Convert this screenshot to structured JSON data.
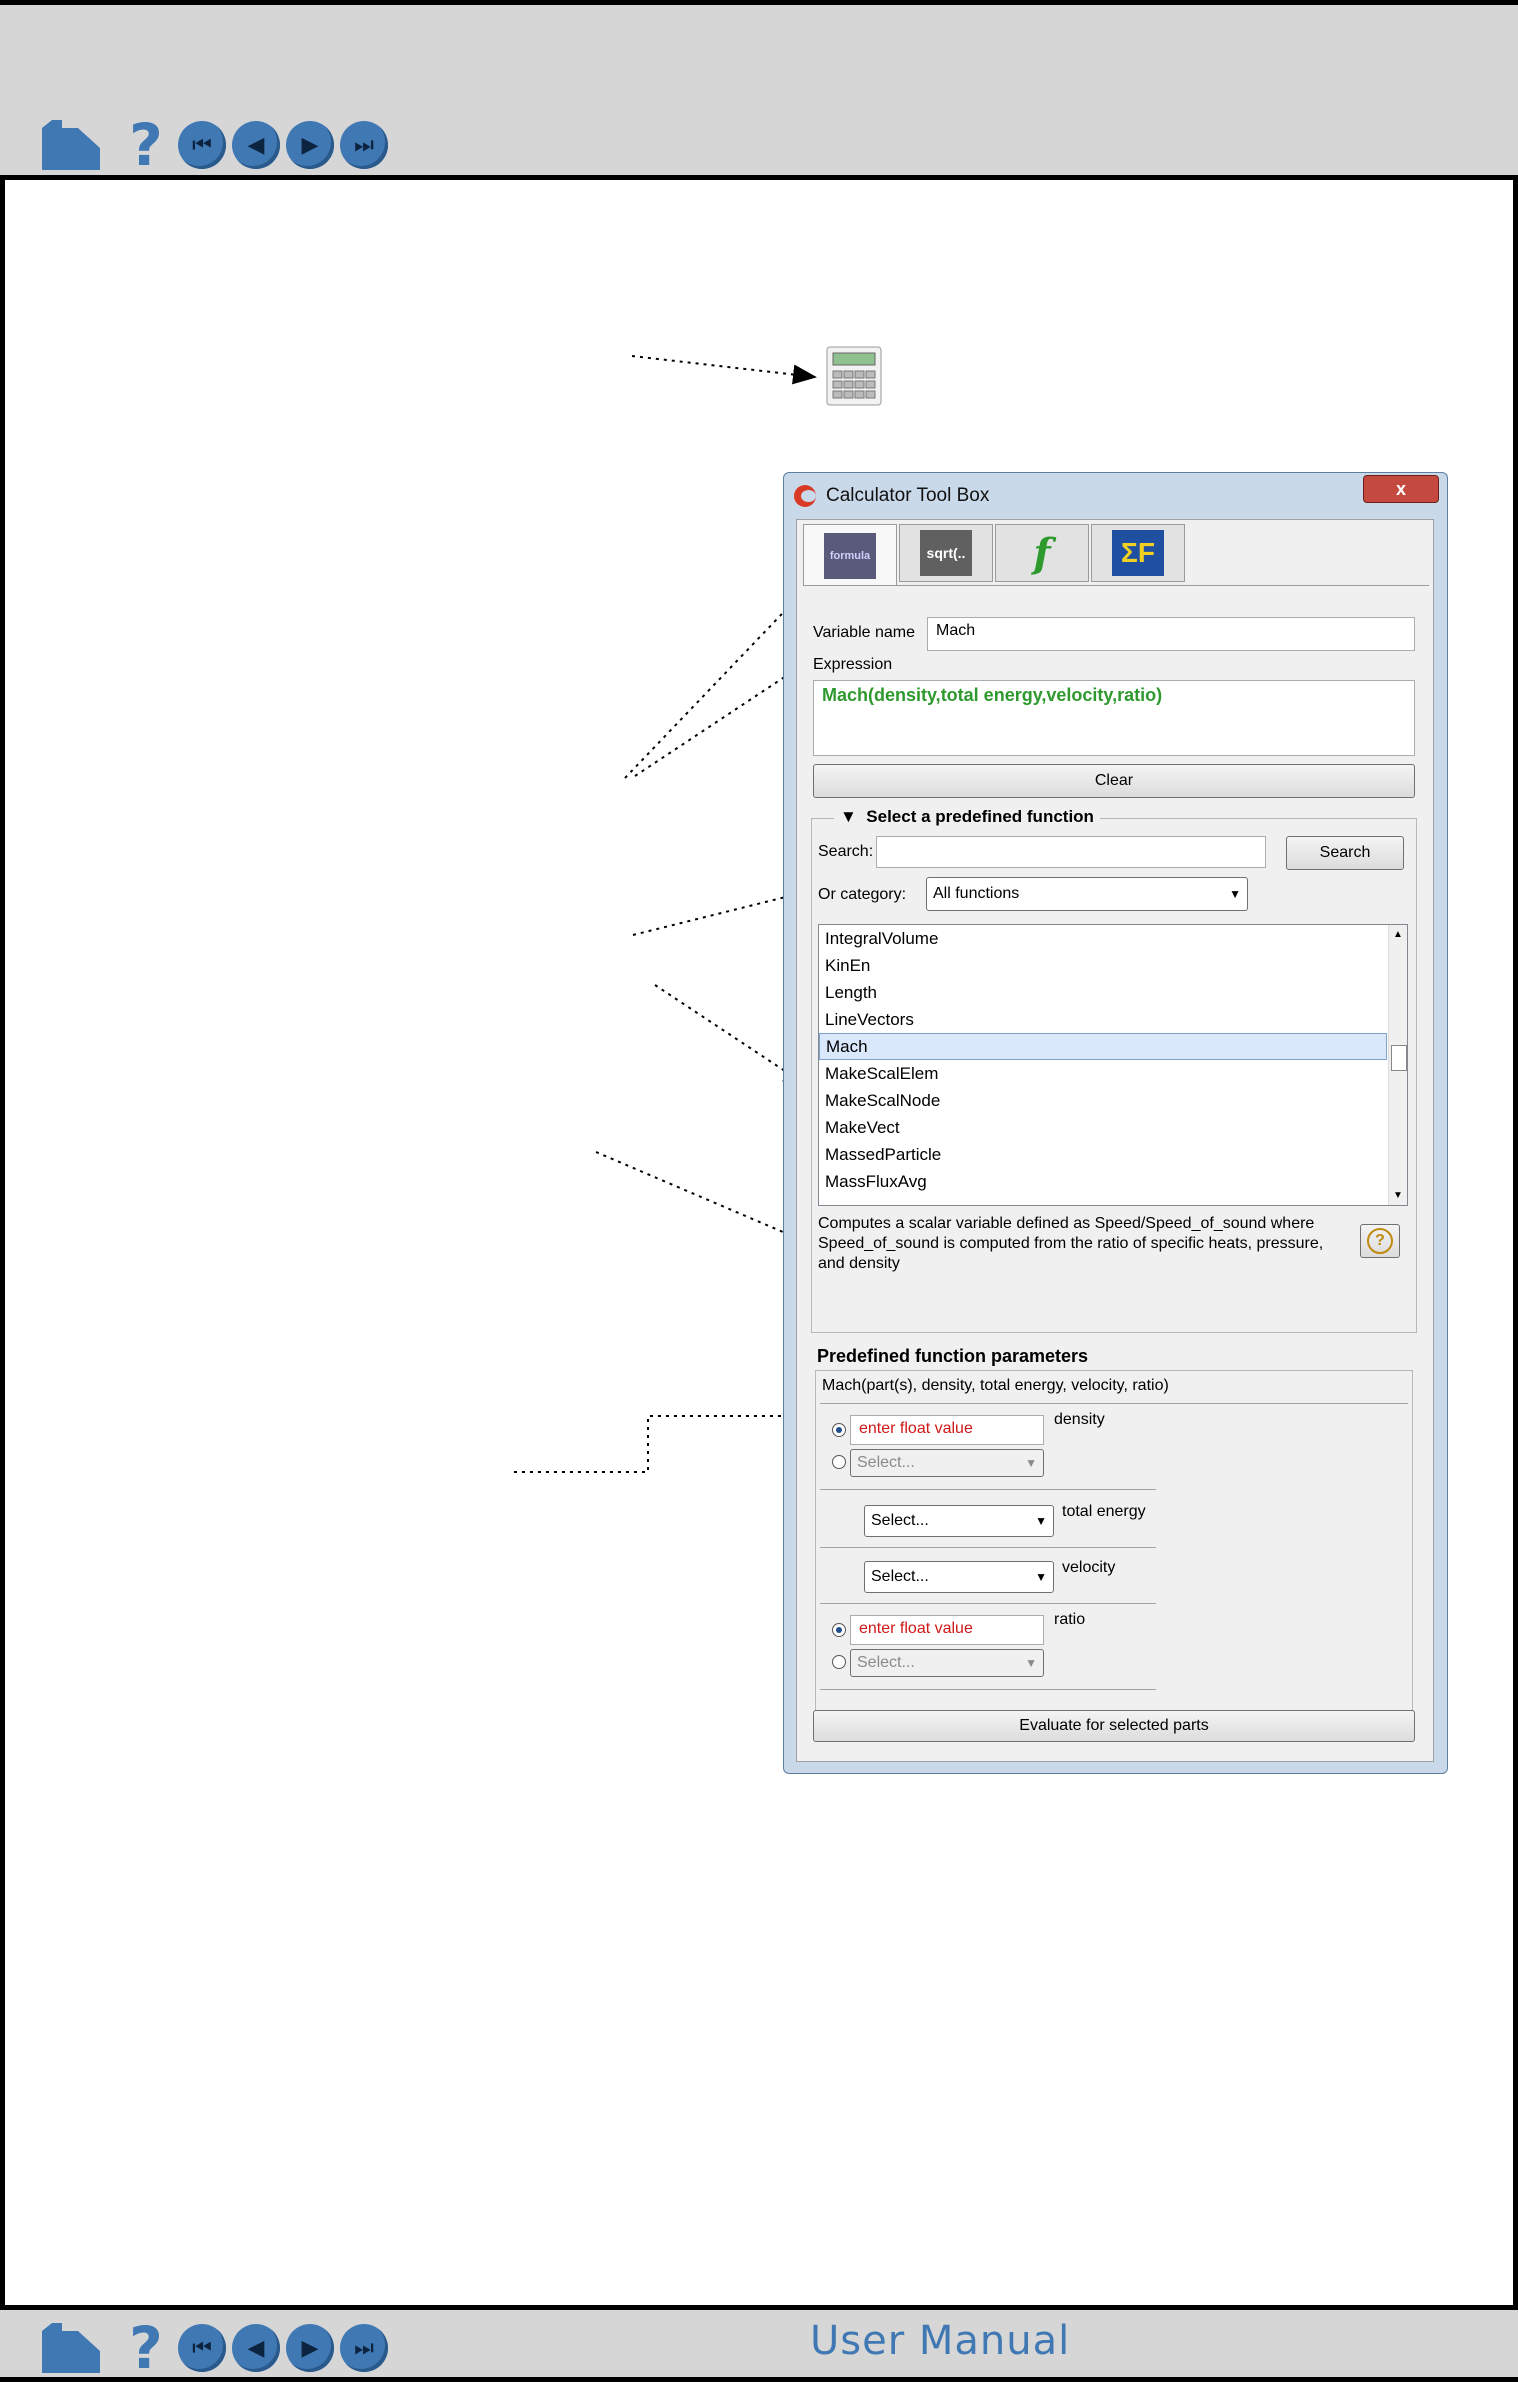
{
  "nav": {
    "home_icon": "home-icon",
    "help_glyph": "?",
    "buttons": [
      "first-page-icon",
      "previous-page-icon",
      "next-page-icon",
      "last-page-icon"
    ],
    "first_glyph": "⏮",
    "prev_glyph": "◀",
    "next_glyph": "▶",
    "last_glyph": "⏭"
  },
  "footer": {
    "title": "User Manual"
  },
  "dialog": {
    "title": "Calculator Tool Box",
    "close_glyph": "x",
    "tabs": [
      {
        "icon": "general-formula-icon",
        "text": "formula"
      },
      {
        "icon": "sqrt-function-icon",
        "text": "sqrt(.."
      },
      {
        "icon": "user-function-icon",
        "text": "f"
      },
      {
        "icon": "sum-function-icon",
        "text": "ΣF"
      }
    ],
    "variable_name_label": "Variable name",
    "variable_name_value": "Mach",
    "expression_label": "Expression",
    "expression_value": "Mach(density,total energy,velocity,ratio)",
    "clear_label": "Clear",
    "predefined_header": "Select a predefined function",
    "search_label": "Search:",
    "search_value": "",
    "search_button": "Search",
    "category_label": "Or category:",
    "category_value": "All functions",
    "functions": [
      "IntegralVolume",
      "KinEn",
      "Length",
      "LineVectors",
      "Mach",
      "MakeScalElem",
      "MakeScalNode",
      "MakeVect",
      "MassedParticle",
      "MassFluxAvg"
    ],
    "selected_function": "Mach",
    "description": "Computes a scalar variable defined as Speed/Speed_of_sound where Speed_of_sound is computed from the ratio of specific heats, pressure, and density",
    "help_glyph": "?",
    "params_header": "Predefined function parameters",
    "params_signature": "Mach(part(s), density, total energy, velocity, ratio)",
    "float_placeholder": "enter float value",
    "select_placeholder": "Select...",
    "param_density": "density",
    "param_total_energy": "total energy",
    "param_velocity": "velocity",
    "param_ratio": "ratio",
    "evaluate_label": "Evaluate for selected parts"
  },
  "colors": {
    "accent": "#3f78b3",
    "expression_green": "#2e9a2e",
    "float_red": "#d01818"
  }
}
